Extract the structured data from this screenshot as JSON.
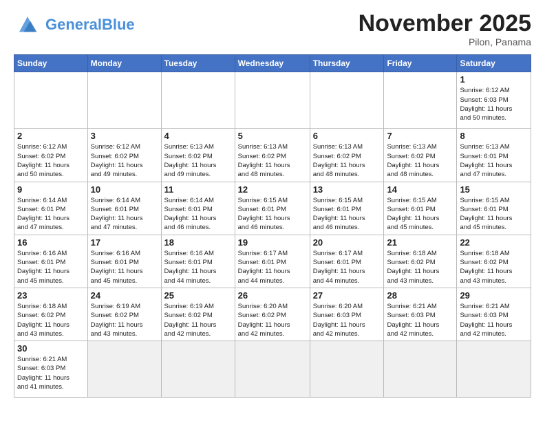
{
  "header": {
    "logo_general": "General",
    "logo_blue": "Blue",
    "month": "November 2025",
    "location": "Pilon, Panama"
  },
  "weekdays": [
    "Sunday",
    "Monday",
    "Tuesday",
    "Wednesday",
    "Thursday",
    "Friday",
    "Saturday"
  ],
  "weeks": [
    [
      {
        "day": "",
        "info": ""
      },
      {
        "day": "",
        "info": ""
      },
      {
        "day": "",
        "info": ""
      },
      {
        "day": "",
        "info": ""
      },
      {
        "day": "",
        "info": ""
      },
      {
        "day": "",
        "info": ""
      },
      {
        "day": "1",
        "info": "Sunrise: 6:12 AM\nSunset: 6:03 PM\nDaylight: 11 hours\nand 50 minutes."
      }
    ],
    [
      {
        "day": "2",
        "info": "Sunrise: 6:12 AM\nSunset: 6:02 PM\nDaylight: 11 hours\nand 50 minutes."
      },
      {
        "day": "3",
        "info": "Sunrise: 6:12 AM\nSunset: 6:02 PM\nDaylight: 11 hours\nand 49 minutes."
      },
      {
        "day": "4",
        "info": "Sunrise: 6:13 AM\nSunset: 6:02 PM\nDaylight: 11 hours\nand 49 minutes."
      },
      {
        "day": "5",
        "info": "Sunrise: 6:13 AM\nSunset: 6:02 PM\nDaylight: 11 hours\nand 48 minutes."
      },
      {
        "day": "6",
        "info": "Sunrise: 6:13 AM\nSunset: 6:02 PM\nDaylight: 11 hours\nand 48 minutes."
      },
      {
        "day": "7",
        "info": "Sunrise: 6:13 AM\nSunset: 6:02 PM\nDaylight: 11 hours\nand 48 minutes."
      },
      {
        "day": "8",
        "info": "Sunrise: 6:13 AM\nSunset: 6:01 PM\nDaylight: 11 hours\nand 47 minutes."
      }
    ],
    [
      {
        "day": "9",
        "info": "Sunrise: 6:14 AM\nSunset: 6:01 PM\nDaylight: 11 hours\nand 47 minutes."
      },
      {
        "day": "10",
        "info": "Sunrise: 6:14 AM\nSunset: 6:01 PM\nDaylight: 11 hours\nand 47 minutes."
      },
      {
        "day": "11",
        "info": "Sunrise: 6:14 AM\nSunset: 6:01 PM\nDaylight: 11 hours\nand 46 minutes."
      },
      {
        "day": "12",
        "info": "Sunrise: 6:15 AM\nSunset: 6:01 PM\nDaylight: 11 hours\nand 46 minutes."
      },
      {
        "day": "13",
        "info": "Sunrise: 6:15 AM\nSunset: 6:01 PM\nDaylight: 11 hours\nand 46 minutes."
      },
      {
        "day": "14",
        "info": "Sunrise: 6:15 AM\nSunset: 6:01 PM\nDaylight: 11 hours\nand 45 minutes."
      },
      {
        "day": "15",
        "info": "Sunrise: 6:15 AM\nSunset: 6:01 PM\nDaylight: 11 hours\nand 45 minutes."
      }
    ],
    [
      {
        "day": "16",
        "info": "Sunrise: 6:16 AM\nSunset: 6:01 PM\nDaylight: 11 hours\nand 45 minutes."
      },
      {
        "day": "17",
        "info": "Sunrise: 6:16 AM\nSunset: 6:01 PM\nDaylight: 11 hours\nand 45 minutes."
      },
      {
        "day": "18",
        "info": "Sunrise: 6:16 AM\nSunset: 6:01 PM\nDaylight: 11 hours\nand 44 minutes."
      },
      {
        "day": "19",
        "info": "Sunrise: 6:17 AM\nSunset: 6:01 PM\nDaylight: 11 hours\nand 44 minutes."
      },
      {
        "day": "20",
        "info": "Sunrise: 6:17 AM\nSunset: 6:01 PM\nDaylight: 11 hours\nand 44 minutes."
      },
      {
        "day": "21",
        "info": "Sunrise: 6:18 AM\nSunset: 6:02 PM\nDaylight: 11 hours\nand 43 minutes."
      },
      {
        "day": "22",
        "info": "Sunrise: 6:18 AM\nSunset: 6:02 PM\nDaylight: 11 hours\nand 43 minutes."
      }
    ],
    [
      {
        "day": "23",
        "info": "Sunrise: 6:18 AM\nSunset: 6:02 PM\nDaylight: 11 hours\nand 43 minutes."
      },
      {
        "day": "24",
        "info": "Sunrise: 6:19 AM\nSunset: 6:02 PM\nDaylight: 11 hours\nand 43 minutes."
      },
      {
        "day": "25",
        "info": "Sunrise: 6:19 AM\nSunset: 6:02 PM\nDaylight: 11 hours\nand 42 minutes."
      },
      {
        "day": "26",
        "info": "Sunrise: 6:20 AM\nSunset: 6:02 PM\nDaylight: 11 hours\nand 42 minutes."
      },
      {
        "day": "27",
        "info": "Sunrise: 6:20 AM\nSunset: 6:03 PM\nDaylight: 11 hours\nand 42 minutes."
      },
      {
        "day": "28",
        "info": "Sunrise: 6:21 AM\nSunset: 6:03 PM\nDaylight: 11 hours\nand 42 minutes."
      },
      {
        "day": "29",
        "info": "Sunrise: 6:21 AM\nSunset: 6:03 PM\nDaylight: 11 hours\nand 42 minutes."
      }
    ],
    [
      {
        "day": "30",
        "info": "Sunrise: 6:21 AM\nSunset: 6:03 PM\nDaylight: 11 hours\nand 41 minutes."
      },
      {
        "day": "",
        "info": ""
      },
      {
        "day": "",
        "info": ""
      },
      {
        "day": "",
        "info": ""
      },
      {
        "day": "",
        "info": ""
      },
      {
        "day": "",
        "info": ""
      },
      {
        "day": "",
        "info": ""
      }
    ]
  ]
}
